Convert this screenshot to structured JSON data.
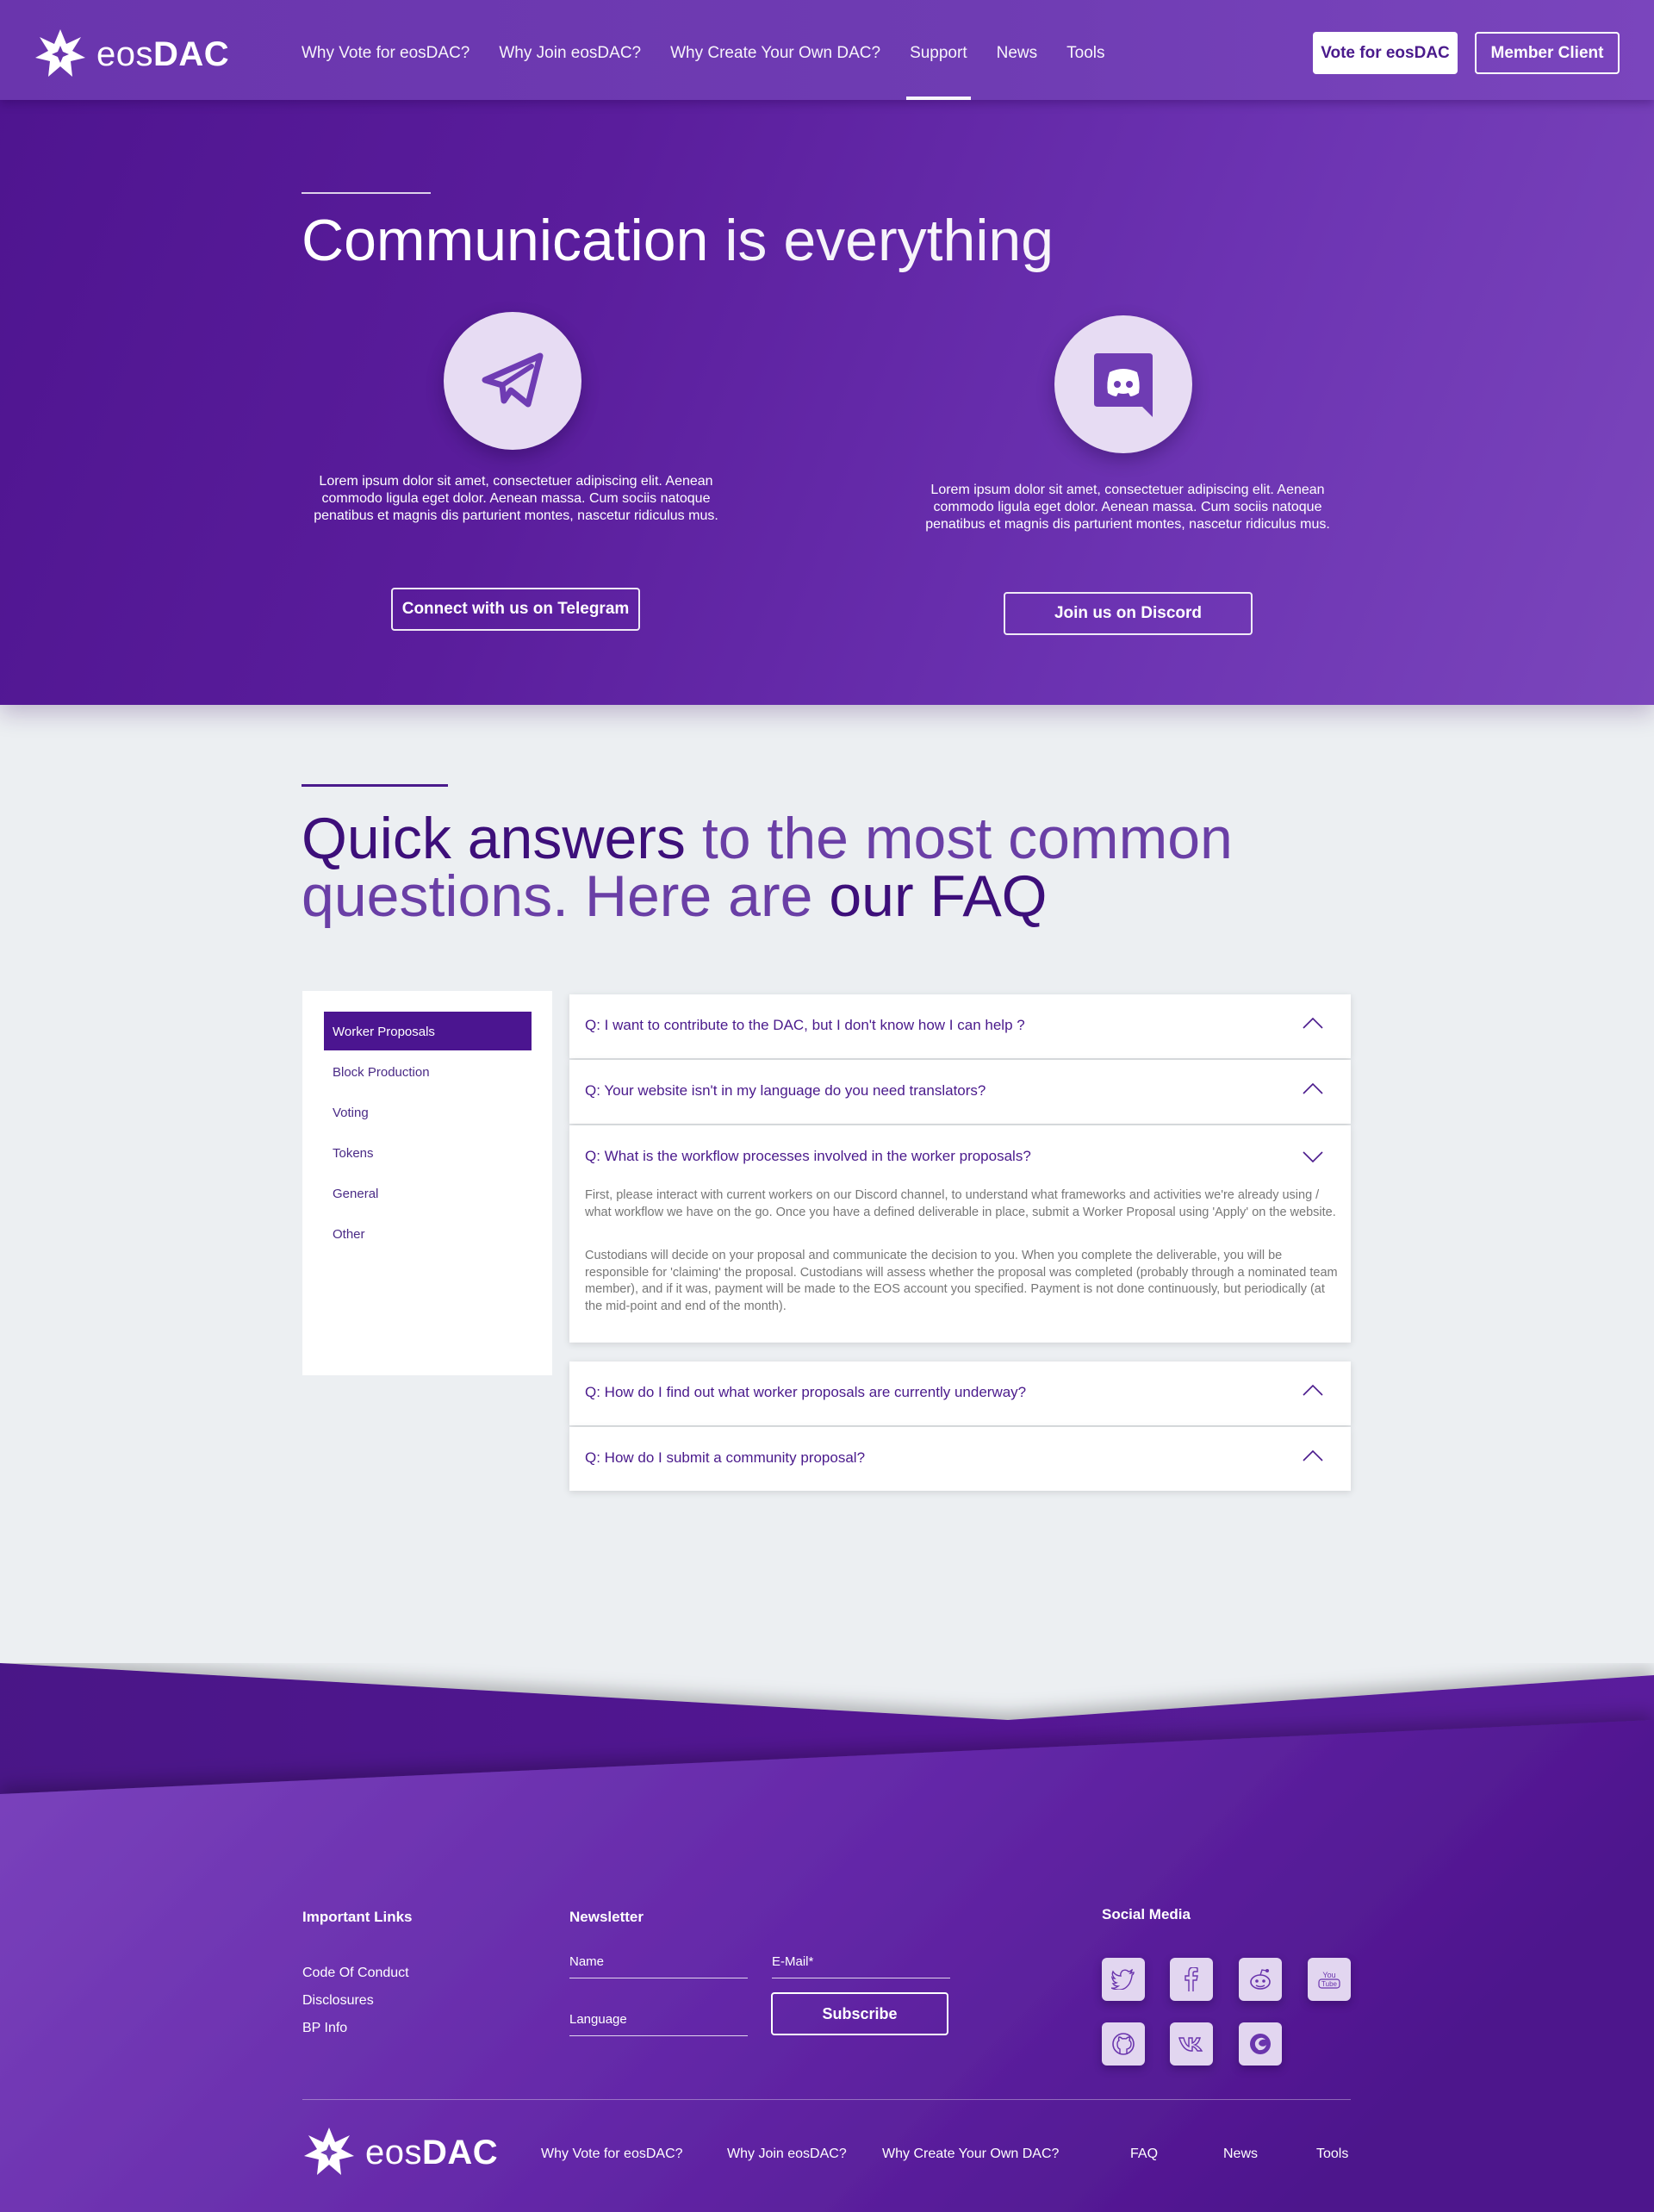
{
  "brand": {
    "light": "eos",
    "bold": "DAC"
  },
  "nav": {
    "items": [
      "Why Vote for eosDAC?",
      "Why Join eosDAC?",
      "Why Create Your Own DAC?",
      "Support",
      "News",
      "Tools"
    ],
    "active": "Support"
  },
  "header_buttons": {
    "vote": "Vote for eosDAC",
    "member": "Member Client"
  },
  "hero": {
    "title_strong": "Communication",
    "title_light": "is everything",
    "telegram": {
      "icon": "telegram-icon",
      "text": "Lorem ipsum dolor sit amet, consectetuer adipiscing elit. Aenean commodo ligula eget dolor. Aenean massa. Cum sociis natoque penatibus et magnis dis parturient montes, nascetur ridiculus mus.",
      "button": "Connect with us on Telegram"
    },
    "discord": {
      "icon": "discord-icon",
      "text": "Lorem ipsum dolor sit amet, consectetuer adipiscing elit. Aenean commodo ligula eget dolor. Aenean massa. Cum sociis natoque penatibus et magnis dis parturient montes, nascetur ridiculus mus.",
      "button": "Join us on Discord"
    }
  },
  "faq": {
    "title_b1": "Quick answers",
    "title_l1": "to the most common",
    "title_l2": "questions. Here are",
    "title_b2": "our FAQ",
    "categories": [
      "Worker Proposals",
      "Block Production",
      "Voting",
      "Tokens",
      "General",
      "Other"
    ],
    "active_category": "Worker Proposals",
    "questions": [
      {
        "q": "Q: I want to contribute to the DAC, but I don't know how I can help ?",
        "expanded": false
      },
      {
        "q": "Q: Your website isn't in my language do you need translators?",
        "expanded": false
      },
      {
        "q": "Q: What is the workflow processes involved in the worker proposals?",
        "expanded": true,
        "a1": "First, please interact with current workers on our Discord channel, to understand what frameworks and activities we're already using / what workflow we have on the go. Once you have a defined deliverable in place, submit a Worker Proposal using 'Apply' on the website.",
        "a2": "Custodians will decide on your proposal and communicate the decision to you. When you complete the deliverable, you will be responsible for 'claiming' the proposal. Custodians will assess whether the proposal was completed (probably through a nominated team member), and if it was, payment will be made to the EOS account you specified. Payment is not done continuously, but periodically (at the mid-point and end of the month)."
      },
      {
        "q": "Q: How do I find out what worker proposals are currently underway?",
        "expanded": false
      },
      {
        "q": "Q: How do I submit a community proposal?",
        "expanded": false
      }
    ]
  },
  "footer": {
    "links_heading": "Important Links",
    "links": [
      "Code Of Conduct",
      "Disclosures",
      "BP Info"
    ],
    "newsletter_heading": "Newsletter",
    "fields": {
      "name": "Name",
      "email": "E-Mail*",
      "language": "Language"
    },
    "subscribe": "Subscribe",
    "social_heading": "Social Media",
    "social": [
      "twitter-icon",
      "facebook-icon",
      "reddit-icon",
      "youtube-icon",
      "github-icon",
      "vk-icon",
      "steemit-icon"
    ],
    "nav": [
      "Why Vote for eosDAC?",
      "Why Join eosDAC?",
      "Why Create Your Own DAC?",
      "FAQ",
      "News",
      "Tools"
    ]
  },
  "colors": {
    "primary": "#4b1590",
    "accent": "#7b46bc",
    "icon_bg": "#e7dcf3",
    "page_bg": "#eceff2"
  }
}
